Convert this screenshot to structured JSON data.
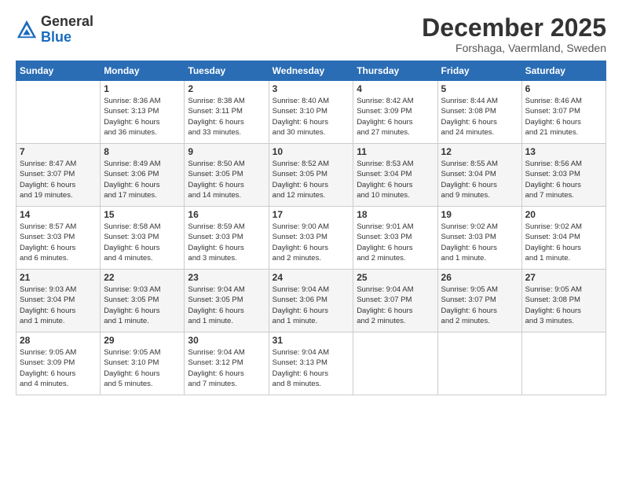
{
  "logo": {
    "general": "General",
    "blue": "Blue"
  },
  "header": {
    "month": "December 2025",
    "location": "Forshaga, Vaermland, Sweden"
  },
  "weekdays": [
    "Sunday",
    "Monday",
    "Tuesday",
    "Wednesday",
    "Thursday",
    "Friday",
    "Saturday"
  ],
  "weeks": [
    [
      {
        "day": "",
        "info": ""
      },
      {
        "day": "1",
        "info": "Sunrise: 8:36 AM\nSunset: 3:13 PM\nDaylight: 6 hours\nand 36 minutes."
      },
      {
        "day": "2",
        "info": "Sunrise: 8:38 AM\nSunset: 3:11 PM\nDaylight: 6 hours\nand 33 minutes."
      },
      {
        "day": "3",
        "info": "Sunrise: 8:40 AM\nSunset: 3:10 PM\nDaylight: 6 hours\nand 30 minutes."
      },
      {
        "day": "4",
        "info": "Sunrise: 8:42 AM\nSunset: 3:09 PM\nDaylight: 6 hours\nand 27 minutes."
      },
      {
        "day": "5",
        "info": "Sunrise: 8:44 AM\nSunset: 3:08 PM\nDaylight: 6 hours\nand 24 minutes."
      },
      {
        "day": "6",
        "info": "Sunrise: 8:46 AM\nSunset: 3:07 PM\nDaylight: 6 hours\nand 21 minutes."
      }
    ],
    [
      {
        "day": "7",
        "info": "Sunrise: 8:47 AM\nSunset: 3:07 PM\nDaylight: 6 hours\nand 19 minutes."
      },
      {
        "day": "8",
        "info": "Sunrise: 8:49 AM\nSunset: 3:06 PM\nDaylight: 6 hours\nand 17 minutes."
      },
      {
        "day": "9",
        "info": "Sunrise: 8:50 AM\nSunset: 3:05 PM\nDaylight: 6 hours\nand 14 minutes."
      },
      {
        "day": "10",
        "info": "Sunrise: 8:52 AM\nSunset: 3:05 PM\nDaylight: 6 hours\nand 12 minutes."
      },
      {
        "day": "11",
        "info": "Sunrise: 8:53 AM\nSunset: 3:04 PM\nDaylight: 6 hours\nand 10 minutes."
      },
      {
        "day": "12",
        "info": "Sunrise: 8:55 AM\nSunset: 3:04 PM\nDaylight: 6 hours\nand 9 minutes."
      },
      {
        "day": "13",
        "info": "Sunrise: 8:56 AM\nSunset: 3:03 PM\nDaylight: 6 hours\nand 7 minutes."
      }
    ],
    [
      {
        "day": "14",
        "info": "Sunrise: 8:57 AM\nSunset: 3:03 PM\nDaylight: 6 hours\nand 6 minutes."
      },
      {
        "day": "15",
        "info": "Sunrise: 8:58 AM\nSunset: 3:03 PM\nDaylight: 6 hours\nand 4 minutes."
      },
      {
        "day": "16",
        "info": "Sunrise: 8:59 AM\nSunset: 3:03 PM\nDaylight: 6 hours\nand 3 minutes."
      },
      {
        "day": "17",
        "info": "Sunrise: 9:00 AM\nSunset: 3:03 PM\nDaylight: 6 hours\nand 2 minutes."
      },
      {
        "day": "18",
        "info": "Sunrise: 9:01 AM\nSunset: 3:03 PM\nDaylight: 6 hours\nand 2 minutes."
      },
      {
        "day": "19",
        "info": "Sunrise: 9:02 AM\nSunset: 3:03 PM\nDaylight: 6 hours\nand 1 minute."
      },
      {
        "day": "20",
        "info": "Sunrise: 9:02 AM\nSunset: 3:04 PM\nDaylight: 6 hours\nand 1 minute."
      }
    ],
    [
      {
        "day": "21",
        "info": "Sunrise: 9:03 AM\nSunset: 3:04 PM\nDaylight: 6 hours\nand 1 minute."
      },
      {
        "day": "22",
        "info": "Sunrise: 9:03 AM\nSunset: 3:05 PM\nDaylight: 6 hours\nand 1 minute."
      },
      {
        "day": "23",
        "info": "Sunrise: 9:04 AM\nSunset: 3:05 PM\nDaylight: 6 hours\nand 1 minute."
      },
      {
        "day": "24",
        "info": "Sunrise: 9:04 AM\nSunset: 3:06 PM\nDaylight: 6 hours\nand 1 minute."
      },
      {
        "day": "25",
        "info": "Sunrise: 9:04 AM\nSunset: 3:07 PM\nDaylight: 6 hours\nand 2 minutes."
      },
      {
        "day": "26",
        "info": "Sunrise: 9:05 AM\nSunset: 3:07 PM\nDaylight: 6 hours\nand 2 minutes."
      },
      {
        "day": "27",
        "info": "Sunrise: 9:05 AM\nSunset: 3:08 PM\nDaylight: 6 hours\nand 3 minutes."
      }
    ],
    [
      {
        "day": "28",
        "info": "Sunrise: 9:05 AM\nSunset: 3:09 PM\nDaylight: 6 hours\nand 4 minutes."
      },
      {
        "day": "29",
        "info": "Sunrise: 9:05 AM\nSunset: 3:10 PM\nDaylight: 6 hours\nand 5 minutes."
      },
      {
        "day": "30",
        "info": "Sunrise: 9:04 AM\nSunset: 3:12 PM\nDaylight: 6 hours\nand 7 minutes."
      },
      {
        "day": "31",
        "info": "Sunrise: 9:04 AM\nSunset: 3:13 PM\nDaylight: 6 hours\nand 8 minutes."
      },
      {
        "day": "",
        "info": ""
      },
      {
        "day": "",
        "info": ""
      },
      {
        "day": "",
        "info": ""
      }
    ]
  ]
}
